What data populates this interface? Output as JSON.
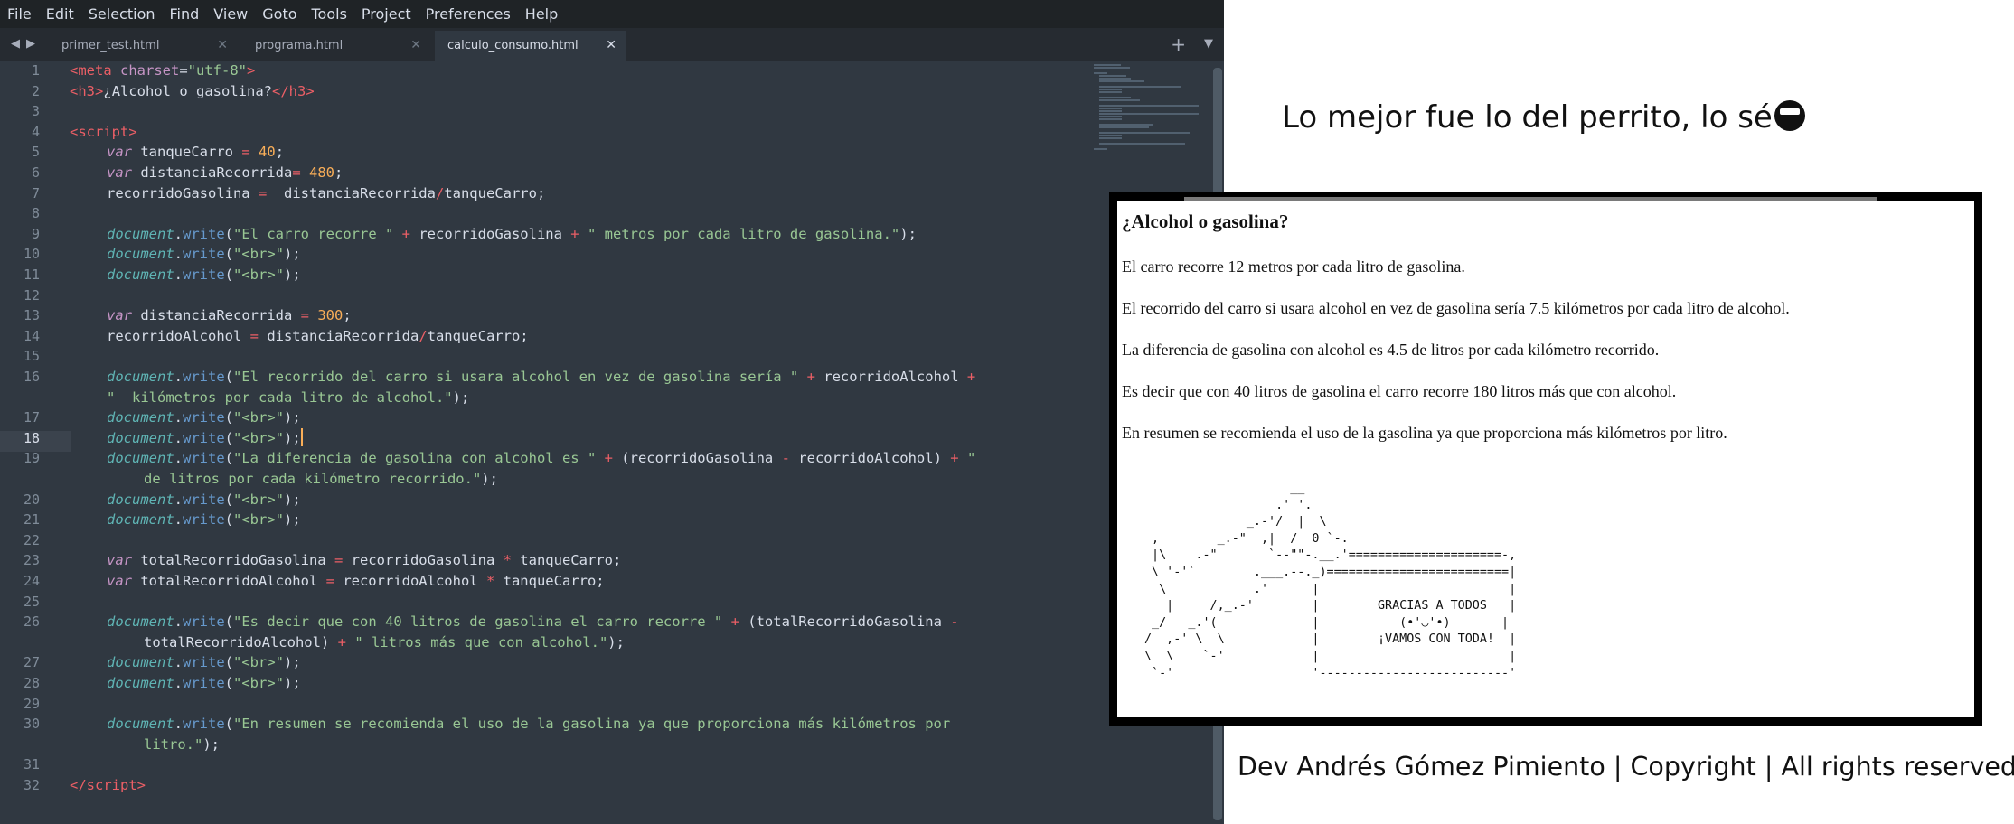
{
  "menu": [
    "File",
    "Edit",
    "Selection",
    "Find",
    "View",
    "Goto",
    "Tools",
    "Project",
    "Preferences",
    "Help"
  ],
  "tabs": [
    {
      "label": "primer_test.html",
      "active": false
    },
    {
      "label": "programa.html",
      "active": false
    },
    {
      "label": "calculo_consumo.html",
      "active": true
    }
  ],
  "tab_icons": {
    "prev": "chevron-left-icon",
    "next": "chevron-right-icon",
    "close": "close-icon",
    "add": "plus-icon",
    "menu": "chevron-down-icon"
  },
  "editor": {
    "current_line": "18",
    "line_numbers": [
      "1",
      "2",
      "3",
      "4",
      "5",
      "6",
      "7",
      "8",
      "9",
      "10",
      "11",
      "12",
      "13",
      "14",
      "15",
      "16",
      "17",
      "18",
      "19",
      "20",
      "21",
      "22",
      "23",
      "24",
      "25",
      "26",
      "27",
      "28",
      "29",
      "30",
      "31",
      "32"
    ],
    "code": {
      "l1": {
        "a": "<",
        "b": "meta",
        "c": " charset",
        "d": "=",
        "e": "\"utf-8\"",
        "f": ">"
      },
      "l2": {
        "a": "<",
        "b": "h3",
        "c": ">",
        "d": "¿Alcohol o gasolina?",
        "e": "</",
        "f": "h3",
        "g": ">"
      },
      "l4": {
        "a": "<",
        "b": "script",
        "c": ">"
      },
      "l5": {
        "a": "var",
        "b": " tanqueCarro ",
        "c": "=",
        "d": " ",
        "e": "40",
        "f": ";"
      },
      "l6": {
        "a": "var",
        "b": " distanciaRecorrida",
        "c": "=",
        "d": " ",
        "e": "480",
        "f": ";"
      },
      "l7": {
        "a": "recorridoGasolina ",
        "b": "=",
        "c": "  distanciaRecorrida",
        "d": "/",
        "e": "tanqueCarro;"
      },
      "l9": {
        "a": "document",
        "b": ".",
        "c": "write",
        "d": "(",
        "e": "\"El carro recorre \"",
        "f": " + ",
        "g": "recorridoGasolina",
        "h": " + ",
        "i": "\" metros por cada litro de gasolina.\"",
        "j": ");"
      },
      "l10": {
        "a": "document",
        "b": ".",
        "c": "write",
        "d": "(",
        "e": "\"<br>\"",
        "f": ");"
      },
      "l11": {
        "a": "document",
        "b": ".",
        "c": "write",
        "d": "(",
        "e": "\"<br>\"",
        "f": ");"
      },
      "l13": {
        "a": "var",
        "b": " distanciaRecorrida ",
        "c": "=",
        "d": " ",
        "e": "300",
        "f": ";"
      },
      "l14": {
        "a": "recorridoAlcohol ",
        "b": "=",
        "c": " distanciaRecorrida",
        "d": "/",
        "e": "tanqueCarro;"
      },
      "l16": {
        "a": "document",
        "b": ".",
        "c": "write",
        "d": "(",
        "e": "\"El recorrido del carro si usara alcohol en vez de gasolina sería \"",
        "f": " + ",
        "g": "recorridoAlcohol",
        "h": " +"
      },
      "l16b": {
        "a": "\"  kilómetros por cada litro de alcohol.\"",
        "b": ");"
      },
      "l17": {
        "a": "document",
        "b": ".",
        "c": "write",
        "d": "(",
        "e": "\"<br>\"",
        "f": ");"
      },
      "l18": {
        "a": "document",
        "b": ".",
        "c": "write",
        "d": "(",
        "e": "\"<br>\"",
        "f": ");"
      },
      "l19": {
        "a": "document",
        "b": ".",
        "c": "write",
        "d": "(",
        "e": "\"La diferencia de gasolina con alcohol es \"",
        "f": " + ",
        "g": "(recorridoGasolina ",
        "h": "-",
        "i": " recorridoAlcohol) ",
        "j": "+",
        "k": " \""
      },
      "l19b": {
        "a": "de litros por cada kilómetro recorrido.\"",
        "b": ");"
      },
      "l20": {
        "a": "document",
        "b": ".",
        "c": "write",
        "d": "(",
        "e": "\"<br>\"",
        "f": ");"
      },
      "l21": {
        "a": "document",
        "b": ".",
        "c": "write",
        "d": "(",
        "e": "\"<br>\"",
        "f": ");"
      },
      "l23": {
        "a": "var",
        "b": " totalRecorridoGasolina ",
        "c": "=",
        "d": " recorridoGasolina ",
        "e": "*",
        "f": " tanqueCarro;"
      },
      "l24": {
        "a": "var",
        "b": " totalRecorridoAlcohol ",
        "c": "=",
        "d": " recorridoAlcohol ",
        "e": "*",
        "f": " tanqueCarro;"
      },
      "l26": {
        "a": "document",
        "b": ".",
        "c": "write",
        "d": "(",
        "e": "\"Es decir que con 40 litros de gasolina el carro recorre \"",
        "f": " + ",
        "g": "(totalRecorridoGasolina ",
        "h": "-"
      },
      "l26b": {
        "a": "totalRecorridoAlcohol) ",
        "b": "+",
        "c": " \" litros más que con alcohol.\"",
        "d": ");"
      },
      "l27": {
        "a": "document",
        "b": ".",
        "c": "write",
        "d": "(",
        "e": "\"<br>\"",
        "f": ");"
      },
      "l28": {
        "a": "document",
        "b": ".",
        "c": "write",
        "d": "(",
        "e": "\"<br>\"",
        "f": ");"
      },
      "l30": {
        "a": "document",
        "b": ".",
        "c": "write",
        "d": "(",
        "e": "\"En resumen se recomienda el uso de la gasolina ya que proporciona más kilómetros por"
      },
      "l30b": {
        "a": "litro.\"",
        "b": ");"
      },
      "l32": {
        "a": "</",
        "b": "script",
        "c": ">"
      }
    }
  },
  "caption": "Lo mejor fue lo del perrito, lo sé",
  "caption_emoji": "sunglasses-emoji-icon",
  "browser": {
    "title": "¿Alcohol o gasolina?",
    "lines": [
      "El carro recorre 12 metros por cada litro de gasolina.",
      "El recorrido del carro si usara alcohol en vez de gasolina sería 7.5 kilómetros por cada litro de alcohol.",
      "La diferencia de gasolina con alcohol es 4.5 de litros por cada kilómetro recorrido.",
      "Es decir que con 40 litros de gasolina el carro recorre 180 litros más que con alcohol.",
      "En resumen se recomienda el uso de la gasolina ya que proporciona más kilómetros por litro."
    ],
    "ascii_art": "                    __\n                  .' '.\n              _.-'/  |  \\\n ,        _.-\"  ,|  /  0 `-.\n |\\    .-\"       `--\"\"-.__.'=====================-,\n \\ '-'`        .___.--._)=========================|\n  \\            .'      |                          |\n   |     /,_.-'        |        GRACIAS A TODOS   |\n _/   _.'(             |           (•'◡'•)       |\n/  ,-' \\  \\            |        ¡VAMOS CON TODA!  |\n\\  \\    `-'            |                          |\n `-'                   '--------------------------'"
  },
  "footer": "Dev Andrés Gómez Pimiento | Copyright | All rights reserved ©"
}
